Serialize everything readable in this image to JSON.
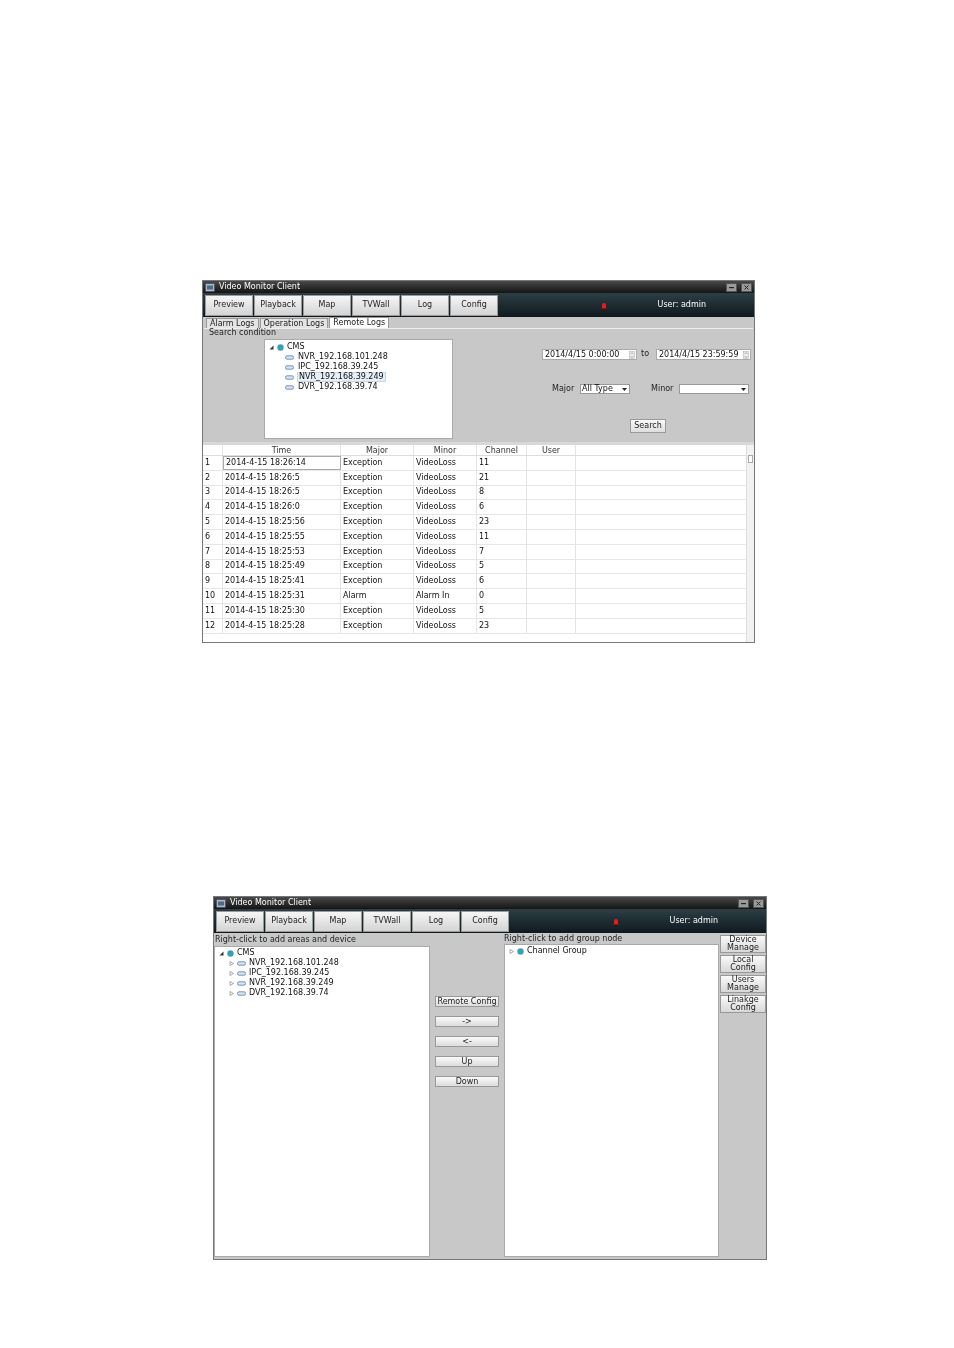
{
  "figures": [
    {
      "kind": "log_view",
      "window": {
        "title": "Video Monitor Client"
      },
      "main_tabs": [
        "Preview",
        "Playback",
        "Map",
        "TVWall",
        "Log",
        "Config"
      ],
      "user_label": "User: admin",
      "sub_tabs": [
        {
          "label": "Alarm Logs",
          "selected": false
        },
        {
          "label": "Operation Logs",
          "selected": false
        },
        {
          "label": "Remote Logs",
          "selected": true
        }
      ],
      "group_title": "Search condition",
      "tree": {
        "label": "CMS",
        "expanded": true,
        "children": [
          {
            "label": "NVR_192.168.101.248",
            "selected": false
          },
          {
            "label": "IPC_192.168.39.245",
            "selected": false
          },
          {
            "label": "NVR_192.168.39.249",
            "selected": true
          },
          {
            "label": "DVR_192.168.39.74",
            "selected": false
          }
        ]
      },
      "start_time": "2014/4/15 0:00:00",
      "to_label": "to",
      "end_time": "2014/4/15 23:59:59",
      "major_label": "Major",
      "major_value": "All Type",
      "minor_label": "Minor",
      "search_button": "Search",
      "table": {
        "columns": [
          "",
          "Time",
          "Major",
          "Minor",
          "Channel",
          "User"
        ],
        "rows": [
          [
            "1",
            "2014-4-15 18:26:14",
            "Exception",
            "VideoLoss",
            "11"
          ],
          [
            "2",
            "2014-4-15 18:26:5",
            "Exception",
            "VideoLoss",
            "21"
          ],
          [
            "3",
            "2014-4-15 18:26:5",
            "Exception",
            "VideoLoss",
            "8"
          ],
          [
            "4",
            "2014-4-15 18:26:0",
            "Exception",
            "VideoLoss",
            "6"
          ],
          [
            "5",
            "2014-4-15 18:25:56",
            "Exception",
            "VideoLoss",
            "23"
          ],
          [
            "6",
            "2014-4-15 18:25:55",
            "Exception",
            "VideoLoss",
            "11"
          ],
          [
            "7",
            "2014-4-15 18:25:53",
            "Exception",
            "VideoLoss",
            "7"
          ],
          [
            "8",
            "2014-4-15 18:25:49",
            "Exception",
            "VideoLoss",
            "5"
          ],
          [
            "9",
            "2014-4-15 18:25:41",
            "Exception",
            "VideoLoss",
            "6"
          ],
          [
            "10",
            "2014-4-15 18:25:31",
            "Alarm",
            "Alarm In",
            "0"
          ],
          [
            "11",
            "2014-4-15 18:25:30",
            "Exception",
            "VideoLoss",
            "5"
          ],
          [
            "12",
            "2014-4-15 18:25:28",
            "Exception",
            "VideoLoss",
            "23"
          ]
        ]
      }
    },
    {
      "kind": "config_view",
      "window": {
        "title": "Video Monitor Client"
      },
      "main_tabs": [
        "Preview",
        "Playback",
        "Map",
        "TVWall",
        "Log",
        "Config"
      ],
      "user_label": "User: admin",
      "left_hint": "Right-click to add areas and device",
      "left_tree": {
        "label": "CMS",
        "expanded": true,
        "children": [
          {
            "label": "NVR_192.168.101.248",
            "expanded": false
          },
          {
            "label": "IPC_192.168.39.245",
            "expanded": false
          },
          {
            "label": "NVR_192.168.39.249",
            "expanded": false
          },
          {
            "label": "DVR_192.168.39.74",
            "expanded": false
          }
        ]
      },
      "middle_buttons": [
        "Remote Config",
        "->",
        "<-",
        "Up",
        "Down"
      ],
      "right_hint": "Right-click to add group node",
      "right_tree": [
        {
          "label": "Channel Group",
          "expanded": false
        }
      ],
      "side_buttons": [
        "Device Manage",
        "Local Config",
        "Users Manage",
        "Linakge Config"
      ]
    }
  ]
}
